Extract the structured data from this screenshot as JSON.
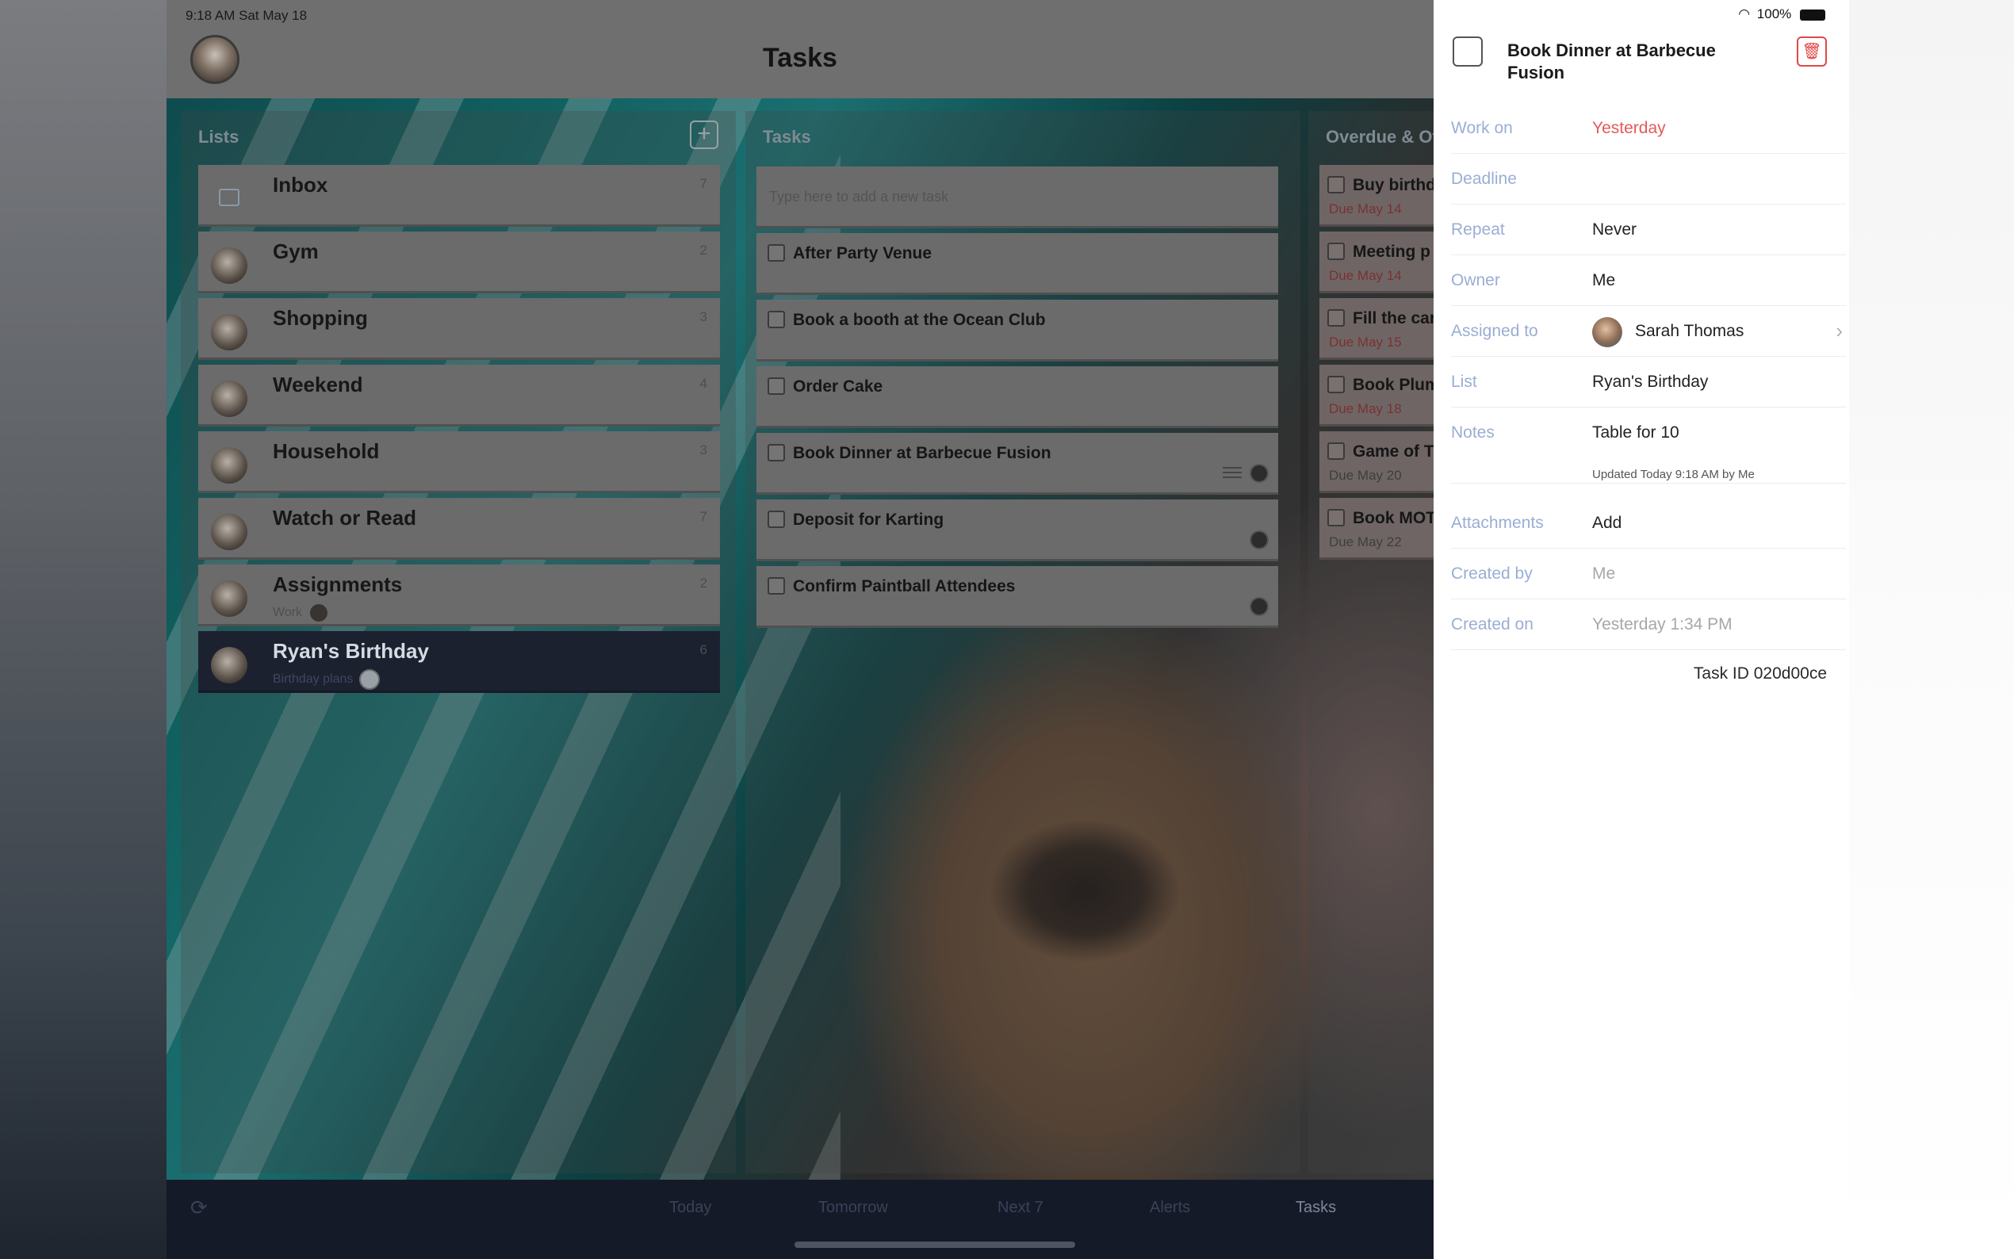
{
  "status": {
    "time_date": "9:18 AM   Sat May 18",
    "battery": "100%"
  },
  "nav": {
    "title": "Tasks"
  },
  "lists": {
    "header": "Lists",
    "items": [
      {
        "name": "Inbox",
        "count": "7",
        "sub": ""
      },
      {
        "name": "Gym",
        "count": "2",
        "sub": ""
      },
      {
        "name": "Shopping",
        "count": "3",
        "sub": ""
      },
      {
        "name": "Weekend",
        "count": "4",
        "sub": ""
      },
      {
        "name": "Household",
        "count": "3",
        "sub": ""
      },
      {
        "name": "Watch or Read",
        "count": "7",
        "sub": ""
      },
      {
        "name": "Assignments",
        "count": "2",
        "sub": "Work"
      },
      {
        "name": "Ryan's Birthday",
        "count": "6",
        "sub": "Birthday plans"
      }
    ]
  },
  "tasks": {
    "header": "Tasks",
    "input_placeholder": "Type here to add a new task",
    "items": [
      {
        "name": "After Party Venue"
      },
      {
        "name": "Book a booth at the Ocean Club"
      },
      {
        "name": "Order Cake"
      },
      {
        "name": "Book Dinner at Barbecue Fusion"
      },
      {
        "name": "Deposit for Karting"
      },
      {
        "name": "Confirm Paintball Attendees"
      }
    ]
  },
  "overdue": {
    "header": "Overdue & Ot",
    "items": [
      {
        "name": "Buy birthd",
        "due": "Due May 14"
      },
      {
        "name": "Meeting p",
        "due": "Due May 14"
      },
      {
        "name": "Fill the car",
        "due": "Due May 15"
      },
      {
        "name": "Book Plum",
        "due": "Due May 18"
      },
      {
        "name": "Game of T",
        "due": "Due May 20"
      },
      {
        "name": "Book MOT",
        "due": "Due May 22"
      }
    ]
  },
  "tabbar": {
    "tabs": [
      "Today",
      "Tomorrow",
      "Next 7",
      "Alerts",
      "Tasks"
    ]
  },
  "detail": {
    "title": "Book Dinner at Barbecue Fusion",
    "fields": {
      "work_on": {
        "label": "Work on",
        "value": "Yesterday"
      },
      "deadline": {
        "label": "Deadline",
        "value": ""
      },
      "repeat": {
        "label": "Repeat",
        "value": "Never"
      },
      "owner": {
        "label": "Owner",
        "value": "Me"
      },
      "assigned_to": {
        "label": "Assigned to",
        "value": "Sarah Thomas"
      },
      "list": {
        "label": "List",
        "value": "Ryan's Birthday"
      },
      "notes": {
        "label": "Notes",
        "value": "Table for 10"
      },
      "attachments": {
        "label": "Attachments",
        "value": "Add"
      },
      "created_by": {
        "label": "Created by",
        "value": "Me"
      },
      "created_on": {
        "label": "Created on",
        "value": "Yesterday 1:34 PM"
      }
    },
    "updated": "Updated Today 9:18 AM by Me",
    "task_id": "Task ID 020d00ce"
  },
  "colors": {
    "accent_label": "#9aaed4",
    "danger": "#e35a5a",
    "tabbar": "#151a28"
  }
}
